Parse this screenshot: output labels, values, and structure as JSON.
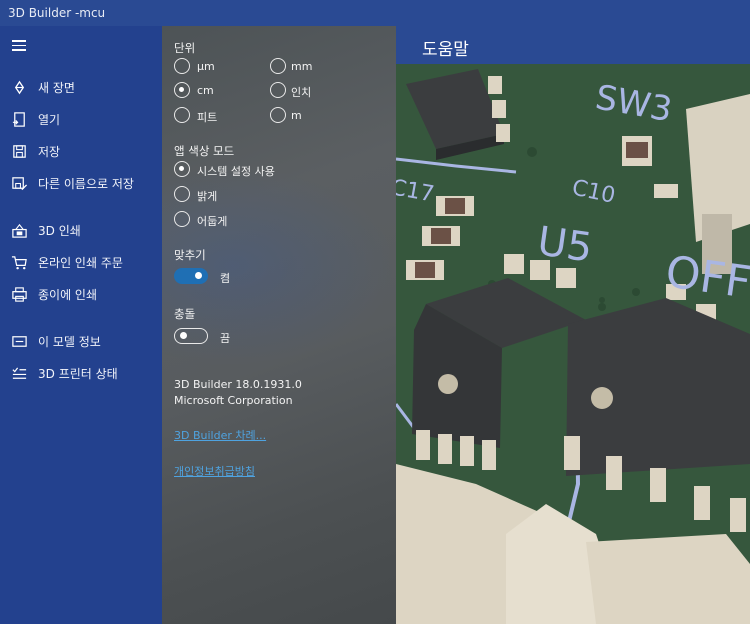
{
  "window": {
    "title": "3D Builder -mcu"
  },
  "sidebar": {
    "items": [
      {
        "label": "새 장면",
        "icon": "new-scene-icon"
      },
      {
        "label": "열기",
        "icon": "open-icon"
      },
      {
        "label": "저장",
        "icon": "save-icon"
      },
      {
        "label": "다른 이름으로 저장",
        "icon": "save-as-icon"
      },
      {
        "label": "3D 인쇄",
        "icon": "3d-print-icon"
      },
      {
        "label": "온라인 인쇄 주문",
        "icon": "cart-icon"
      },
      {
        "label": "종이에 인쇄",
        "icon": "printer-icon"
      },
      {
        "label": "이 모델 정보",
        "icon": "info-icon"
      },
      {
        "label": "3D 프린터 상태",
        "icon": "printer-status-icon"
      }
    ]
  },
  "settings": {
    "units": {
      "heading": "단위",
      "options": [
        "μm",
        "mm",
        "cm",
        "인치",
        "피트",
        "m"
      ],
      "selected": "cm"
    },
    "app_color_mode": {
      "heading": "앱 색상 모드",
      "options": [
        "시스템 설정 사용",
        "밝게",
        "어둡게"
      ],
      "selected": "시스템 설정 사용"
    },
    "snap": {
      "heading": "맞추기",
      "state_label": "켬",
      "on": true
    },
    "collision": {
      "heading": "충돌",
      "state_label": "끔",
      "on": false
    },
    "about": {
      "version": "3D Builder 18.0.1931.0",
      "company": "Microsoft Corporation",
      "link_intro": "3D Builder 차례...",
      "link_privacy": "개인정보취급방침"
    }
  },
  "help": {
    "title": "도움말"
  },
  "viewport": {
    "silkscreen": [
      "SW3",
      "C10",
      "C17",
      "U5",
      "OFF"
    ],
    "colors": {
      "board": "#36573d",
      "chip": "#3b3d3f",
      "connector": "#ddd5c3",
      "trace": "#a9b6e3"
    }
  }
}
